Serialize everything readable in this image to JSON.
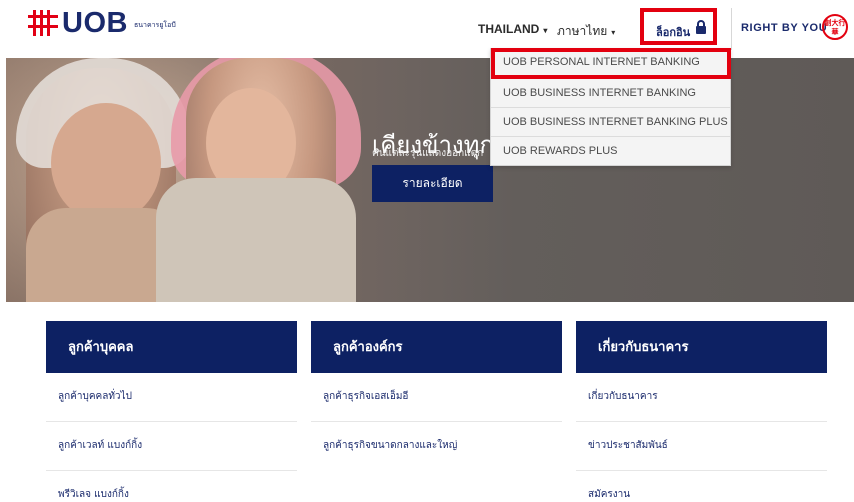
{
  "header": {
    "brand": "UOB",
    "brand_sub": "ธนาคารยูโอบี",
    "nav_country": "THAILAND",
    "nav_language": "ภาษาไทย",
    "login_label": "ล็อกอิน",
    "tagline": "RIGHT BY YOU",
    "seal_text": "創大行華"
  },
  "login_dropdown": {
    "items": [
      "UOB PERSONAL INTERNET BANKING",
      "UOB BUSINESS INTERNET BANKING",
      "UOB BUSINESS INTERNET BANKING PLUS",
      "UOB REWARDS PLUS"
    ]
  },
  "hero": {
    "title": "เคียงข้างทุก",
    "subtitle": "คนแต่ละรุ่นแสดงออกแตก",
    "button": "รายละเอียด"
  },
  "columns": [
    {
      "title": "ลูกค้าบุคคล",
      "links": [
        "ลูกค้าบุคคลทั่วไป",
        "ลูกค้าเวลท์ แบงก์กิ้ง",
        "พรีวิเลจ แบงก์กิ้ง"
      ]
    },
    {
      "title": "ลูกค้าองค์กร",
      "links": [
        "ลูกค้าธุรกิจเอสเอ็มอี",
        "ลูกค้าธุรกิจขนาดกลางและใหญ่"
      ]
    },
    {
      "title": "เกี่ยวกับธนาคาร",
      "links": [
        "เกี่ยวกับธนาคาร",
        "ข่าวประชาสัมพันธ์",
        "สมัครงาน"
      ]
    }
  ],
  "colors": {
    "brand_navy": "#0d2163",
    "brand_red": "#e3000f",
    "dropdown_bg": "#f4f4f4"
  },
  "icons": [
    "uob-logo-icon",
    "caret-down-icon",
    "lock-icon",
    "seal-icon"
  ]
}
